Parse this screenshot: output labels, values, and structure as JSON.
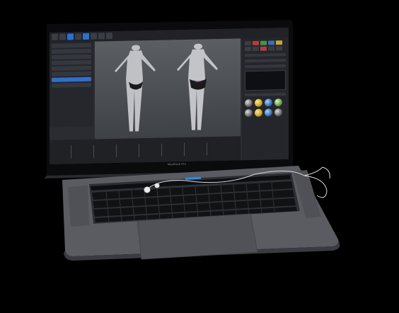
{
  "scene": {
    "brand_label": "MacBook Pro",
    "colors": {
      "body": "#55575d",
      "keyboard_well": "#2e2f34",
      "key": "#111214",
      "touch_bar_accent": "#2b8de8",
      "screen_bg": "#2a2c31",
      "viewport_bg": "#4b4e53",
      "selection": "#2f6fcc"
    },
    "icons": [
      "earphones-icon",
      "model-figure-front",
      "model-figure-back"
    ]
  }
}
